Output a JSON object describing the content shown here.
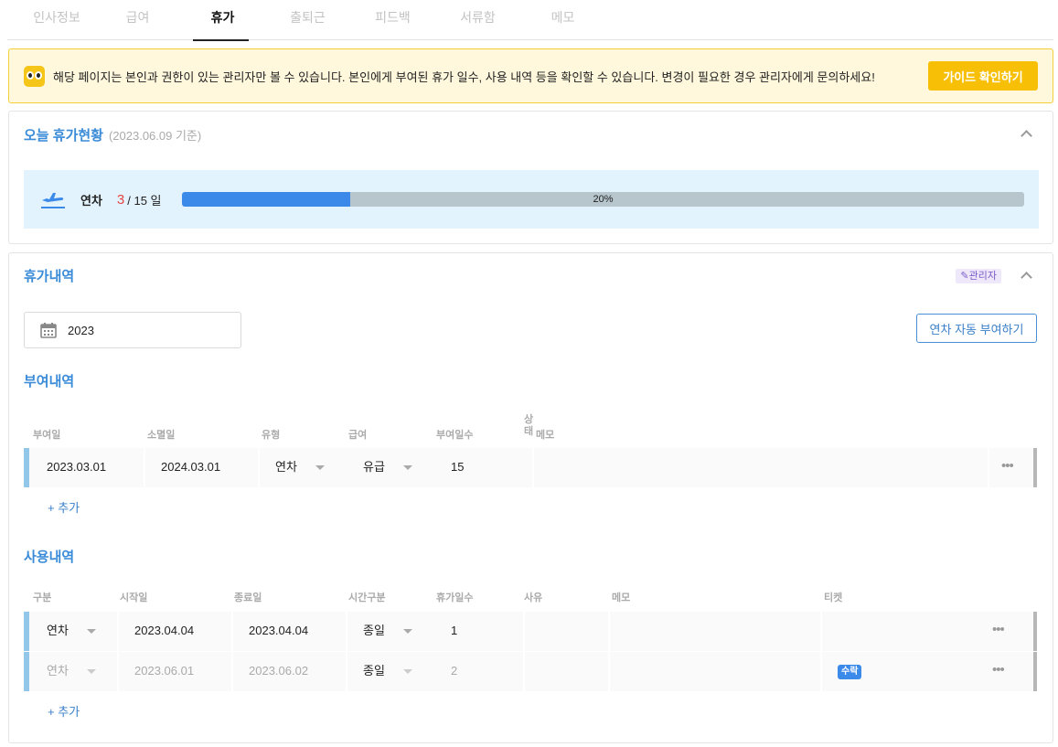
{
  "tabs": [
    {
      "label": "인사정보",
      "active": false
    },
    {
      "label": "급여",
      "active": false
    },
    {
      "label": "휴가",
      "active": true
    },
    {
      "label": "출퇴근",
      "active": false
    },
    {
      "label": "피드백",
      "active": false
    },
    {
      "label": "서류함",
      "active": false
    },
    {
      "label": "메모",
      "active": false
    }
  ],
  "notice": {
    "icon": "owl-icon",
    "text": "해당 페이지는 본인과 권한이 있는 관리자만 볼 수 있습니다. 본인에게 부여된 휴가 일수, 사용 내역 등을 확인할 수 있습니다. 변경이 필요한 경우 관리자에게 문의하세요!",
    "button": "가이드 확인하기"
  },
  "today_status": {
    "title": "오늘 휴가현황",
    "date_note": "(2023.06.09 기준)",
    "leave_type": "연차",
    "used": "3",
    "total": "/ 15 일",
    "progress_label": "20%",
    "progress_fraction": 0.2
  },
  "history": {
    "title": "휴가내역",
    "admin_badge": "관리자",
    "year": "2023",
    "auto_button": "연차 자동 부여하기",
    "grant": {
      "title": "부여내역",
      "headers": [
        "부여일",
        "소멸일",
        "유형",
        "급여",
        "부여일수",
        "상태",
        "메모"
      ],
      "rows": [
        {
          "grant_date": "2023.03.01",
          "expire_date": "2024.03.01",
          "type": "연차",
          "pay": "유급",
          "days": "15"
        }
      ],
      "add_label": "+ 추가"
    },
    "usage": {
      "title": "사용내역",
      "headers": [
        "구분",
        "시작일",
        "종료일",
        "시간구분",
        "휴가일수",
        "사유",
        "메모",
        "티켓"
      ],
      "rows": [
        {
          "type": "연차",
          "start": "2023.04.04",
          "end": "2023.04.04",
          "time": "종일",
          "days": "1",
          "ticket": ""
        },
        {
          "type": "연차",
          "start": "2023.06.01",
          "end": "2023.06.02",
          "time": "종일",
          "days": "2",
          "ticket": "수락"
        }
      ],
      "add_label": "+ 추가"
    }
  },
  "colors": {
    "accent": "#3a8bd8",
    "progress": "#3b89e9",
    "used": "#e54545",
    "guide_button": "#f8bf07"
  }
}
